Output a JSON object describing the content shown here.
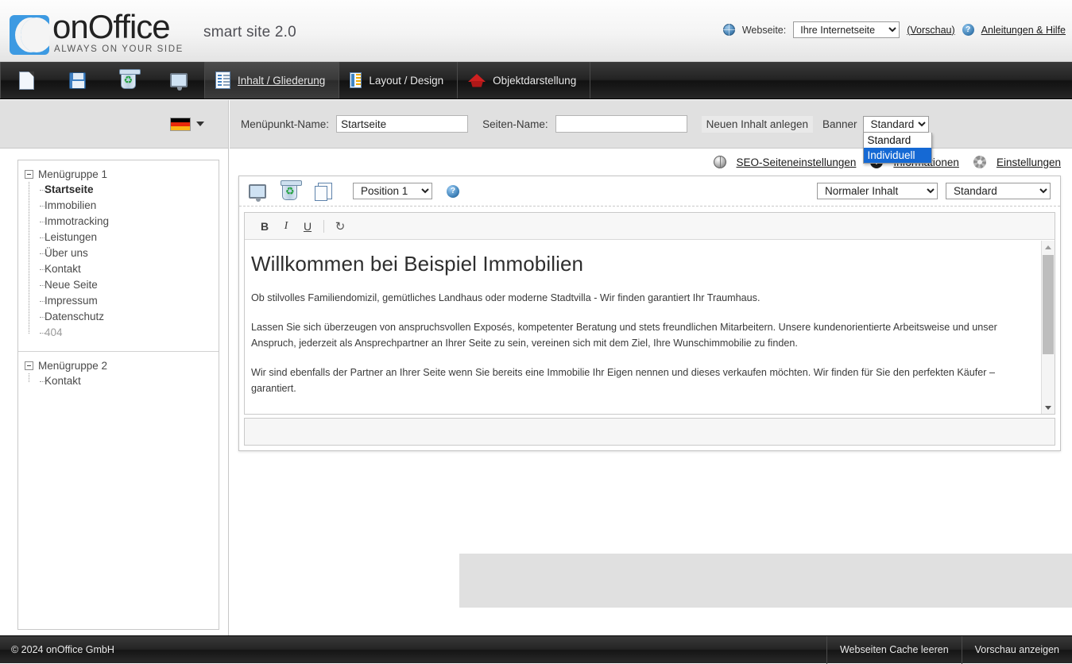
{
  "header": {
    "logo_word": "onOffice",
    "logo_tagline": "ALWAYS ON YOUR SIDE",
    "product_name": "smart site 2.0",
    "website_label": "Webseite:",
    "website_selected": "Ihre Internetseite",
    "website_options": [
      "Ihre Internetseite"
    ],
    "preview_link": "(Vorschau)",
    "help_link": "Anleitungen & Hilfe",
    "globe_icon": "globe-icon",
    "help_icon": "help-circle-icon"
  },
  "navbar": {
    "icon_buttons": [
      {
        "name": "new-page-icon",
        "title": "Neue Seite"
      },
      {
        "name": "save-icon",
        "title": "Speichern"
      },
      {
        "name": "recycle-bin-icon",
        "title": "Papierkorb"
      },
      {
        "name": "preview-monitor-icon",
        "title": "Vorschau"
      }
    ],
    "tabs": [
      {
        "label": "Inhalt / Gliederung",
        "icon": "content-structure-icon",
        "active": true
      },
      {
        "label": "Layout / Design",
        "icon": "layout-design-icon",
        "active": false
      },
      {
        "label": "Objektdarstellung",
        "icon": "object-presentation-icon",
        "active": false
      }
    ]
  },
  "sidebar": {
    "language_flag": "german-flag-icon",
    "groups": [
      {
        "title": "Menügruppe 1",
        "items": [
          {
            "label": "Startseite",
            "selected": true,
            "muted": false
          },
          {
            "label": "Immobilien",
            "selected": false,
            "muted": false
          },
          {
            "label": "Immotracking",
            "selected": false,
            "muted": false
          },
          {
            "label": "Leistungen",
            "selected": false,
            "muted": false
          },
          {
            "label": "Über uns",
            "selected": false,
            "muted": false
          },
          {
            "label": "Kontakt",
            "selected": false,
            "muted": false
          },
          {
            "label": "Neue Seite",
            "selected": false,
            "muted": false
          },
          {
            "label": "Impressum",
            "selected": false,
            "muted": false
          },
          {
            "label": "Datenschutz",
            "selected": false,
            "muted": false
          },
          {
            "label": "404",
            "selected": false,
            "muted": true
          }
        ]
      },
      {
        "title": "Menügruppe 2",
        "items": [
          {
            "label": "Kontakt",
            "selected": false,
            "muted": false
          }
        ]
      }
    ]
  },
  "form_bar": {
    "menupunkt_label": "Menüpunkt-Name:",
    "menupunkt_value": "Startseite",
    "seiten_label": "Seiten-Name:",
    "seiten_value": "",
    "new_content_button": "Neuen Inhalt anlegen",
    "banner_label": "Banner",
    "banner_selected": "Standard",
    "banner_options": [
      {
        "label": "Standard",
        "highlighted": false
      },
      {
        "label": "Individuell",
        "highlighted": true
      }
    ],
    "dropdown_open": true,
    "highlight_color": "#1569d4"
  },
  "tools_row": {
    "seo_link": "SEO-Seiteneinstellungen",
    "seo_icon": "globe-icon",
    "info_link": "Informationen",
    "info_icon": "info-circle-icon",
    "settings_link": "Einstellungen",
    "settings_icon": "gear-icon"
  },
  "content_card": {
    "toolbar": {
      "preview_icon": "monitor-preview-icon",
      "delete_icon": "recycle-bin-icon",
      "copy_icon": "copy-pages-icon",
      "position_selected": "Position 1",
      "position_options": [
        "Position 1"
      ],
      "help_icon": "help-circle-icon",
      "content_type_selected": "Normaler Inhalt",
      "content_type_options": [
        "Normaler Inhalt"
      ],
      "style_selected": "Standard",
      "style_options": [
        "Standard"
      ]
    },
    "format_bar": {
      "bold": "B",
      "italic": "I",
      "underline": "U",
      "refresh_icon": "refresh-icon"
    },
    "document": {
      "title": "Willkommen bei Beispiel Immobilien",
      "paragraphs": [
        "Ob stilvolles Familiendomizil, gemütliches Landhaus oder moderne Stadtvilla - Wir finden garantiert Ihr Traumhaus.",
        "Lassen Sie sich überzeugen von anspruchsvollen Exposés, kompetenter Beratung und stets freundlichen Mitarbeitern. Unsere kundenorientierte Arbeitsweise und unser Anspruch, jederzeit als Ansprechpartner an Ihrer Seite zu sein, vereinen sich mit dem Ziel, Ihre Wunschimmobilie zu finden.",
        "Wir sind ebenfalls der Partner an Ihrer Seite wenn Sie bereits eine Immobilie Ihr Eigen nennen und dieses verkaufen möchten. Wir finden für Sie den perfekten Käufer – garantiert."
      ]
    }
  },
  "footer": {
    "copyright": "© 2024 onOffice GmbH",
    "buttons": [
      {
        "label": "Webseiten Cache leeren"
      },
      {
        "label": "Vorschau anzeigen"
      }
    ]
  }
}
